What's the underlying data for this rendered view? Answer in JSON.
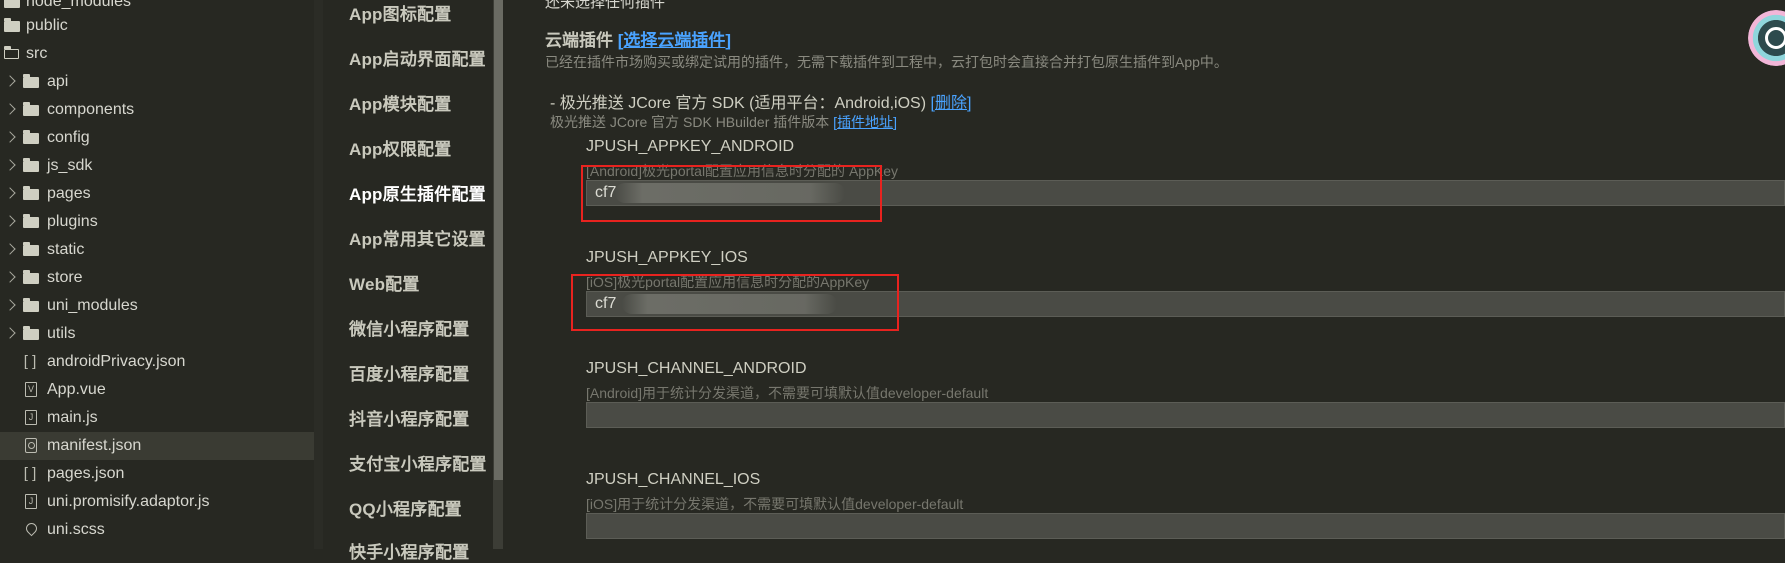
{
  "tree": {
    "items": [
      {
        "label": "node_modules",
        "type": "folder"
      },
      {
        "label": "public",
        "type": "folder"
      },
      {
        "label": "src",
        "type": "folder-open"
      },
      {
        "label": "api",
        "type": "folder"
      },
      {
        "label": "components",
        "type": "folder"
      },
      {
        "label": "config",
        "type": "folder"
      },
      {
        "label": "js_sdk",
        "type": "folder"
      },
      {
        "label": "pages",
        "type": "folder"
      },
      {
        "label": "plugins",
        "type": "folder"
      },
      {
        "label": "static",
        "type": "folder"
      },
      {
        "label": "store",
        "type": "folder"
      },
      {
        "label": "uni_modules",
        "type": "folder"
      },
      {
        "label": "utils",
        "type": "folder"
      },
      {
        "label": "androidPrivacy.json",
        "type": "json"
      },
      {
        "label": "App.vue",
        "type": "vue"
      },
      {
        "label": "main.js",
        "type": "js"
      },
      {
        "label": "manifest.json",
        "type": "manifest"
      },
      {
        "label": "pages.json",
        "type": "json"
      },
      {
        "label": "uni.promisify.adaptor.js",
        "type": "js"
      },
      {
        "label": "uni.scss",
        "type": "scss"
      }
    ]
  },
  "nav": {
    "items": [
      "App图标配置",
      "App启动界面配置",
      "App模块配置",
      "App权限配置",
      "App原生插件配置",
      "App常用其它设置",
      "Web配置",
      "微信小程序配置",
      "百度小程序配置",
      "抖音小程序配置",
      "支付宝小程序配置",
      "QQ小程序配置",
      "快手小程序配置"
    ],
    "active": "App原生插件配置"
  },
  "main": {
    "top_text": "还未选择任何插件",
    "cloud": {
      "title": "云端插件",
      "bracket_open": "[",
      "select_link": "选择云端插件",
      "bracket_close": "]",
      "desc": "已经在插件市场购买或绑定试用的插件，无需下载插件到工程中，云打包时会直接合并打包原生插件到App中。"
    },
    "plugin": {
      "name": "- 极光推送 JCore 官方 SDK (适用平台：Android,iOS)",
      "delete_link": "删除",
      "version_text": "极光推送 JCore 官方 SDK HBuilder 插件版本",
      "address_link": "插件地址"
    },
    "fields": [
      {
        "key": "JPUSH_APPKEY_ANDROID",
        "hint": "[Android]极光portal配置应用信息时分配的 AppKey",
        "value": "cf7"
      },
      {
        "key": "JPUSH_APPKEY_IOS",
        "hint": "[iOS]极光portal配置应用信息时分配的AppKey",
        "value": "cf7"
      },
      {
        "key": "JPUSH_CHANNEL_ANDROID",
        "hint": "[Android]用于统计分发渠道，不需要可填默认值developer-default",
        "value": ""
      },
      {
        "key": "JPUSH_CHANNEL_IOS",
        "hint": "[iOS]用于统计分发渠道，不需要可填默认值developer-default",
        "value": ""
      }
    ]
  },
  "colors": {
    "background": "#272822",
    "link": "#4aa3ff",
    "highlight_box": "#e8231f",
    "field_bg": "#4a4b45"
  }
}
